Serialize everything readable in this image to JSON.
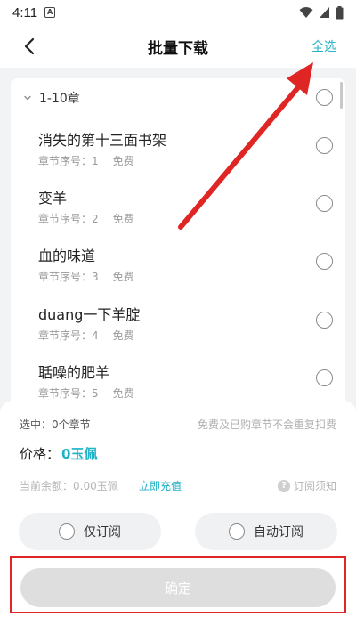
{
  "status_bar": {
    "time": "4:11",
    "notification_letter": "A"
  },
  "header": {
    "title": "批量下载",
    "select_all": "全选"
  },
  "group": {
    "label": "1-10章"
  },
  "chapters": [
    {
      "title": "消失的第十三面书架",
      "meta": "章节序号：1",
      "price": "免费"
    },
    {
      "title": "变羊",
      "meta": "章节序号：2",
      "price": "免费"
    },
    {
      "title": "血的味道",
      "meta": "章节序号：3",
      "price": "免费"
    },
    {
      "title": "duang一下羊腚",
      "meta": "章节序号：4",
      "price": "免费"
    },
    {
      "title": "聒噪的肥羊",
      "meta": "章节序号：5",
      "price": "免费"
    }
  ],
  "panel": {
    "selected": "选中：0个章节",
    "note": "免费及已购章节不会重复扣费",
    "price_label": "价格：",
    "price_value": "0玉佩",
    "balance": "当前余额：0.00玉佩",
    "recharge": "立即充值",
    "notice": "订阅须知",
    "option_subscribe_only": "仅订阅",
    "option_auto_subscribe": "自动订阅",
    "confirm": "确定"
  },
  "colors": {
    "accent": "#20b2c6",
    "annotation_red": "#e02525",
    "disabled_button": "#dedede"
  }
}
